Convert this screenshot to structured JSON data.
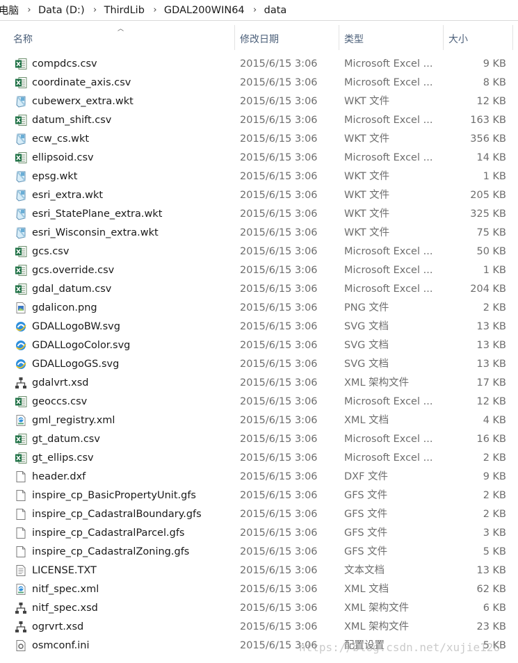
{
  "breadcrumb": {
    "segments": [
      "电脑",
      "Data (D:)",
      "ThirdLib",
      "GDAL200WIN64",
      "data"
    ],
    "separator": "›"
  },
  "columns": {
    "name": "名称",
    "date": "修改日期",
    "type": "类型",
    "size": "大小"
  },
  "files": [
    {
      "name": "compdcs.csv",
      "date": "2015/6/15 3:06",
      "type": "Microsoft Excel ...",
      "size": "9 KB",
      "icon": "excel-icon"
    },
    {
      "name": "coordinate_axis.csv",
      "date": "2015/6/15 3:06",
      "type": "Microsoft Excel ...",
      "size": "8 KB",
      "icon": "excel-icon"
    },
    {
      "name": "cubewerx_extra.wkt",
      "date": "2015/6/15 3:06",
      "type": "WKT 文件",
      "size": "12 KB",
      "icon": "wkt-icon"
    },
    {
      "name": "datum_shift.csv",
      "date": "2015/6/15 3:06",
      "type": "Microsoft Excel ...",
      "size": "163 KB",
      "icon": "excel-icon"
    },
    {
      "name": "ecw_cs.wkt",
      "date": "2015/6/15 3:06",
      "type": "WKT 文件",
      "size": "356 KB",
      "icon": "wkt-icon"
    },
    {
      "name": "ellipsoid.csv",
      "date": "2015/6/15 3:06",
      "type": "Microsoft Excel ...",
      "size": "14 KB",
      "icon": "excel-icon"
    },
    {
      "name": "epsg.wkt",
      "date": "2015/6/15 3:06",
      "type": "WKT 文件",
      "size": "1 KB",
      "icon": "wkt-icon"
    },
    {
      "name": "esri_extra.wkt",
      "date": "2015/6/15 3:06",
      "type": "WKT 文件",
      "size": "205 KB",
      "icon": "wkt-icon"
    },
    {
      "name": "esri_StatePlane_extra.wkt",
      "date": "2015/6/15 3:06",
      "type": "WKT 文件",
      "size": "325 KB",
      "icon": "wkt-icon"
    },
    {
      "name": "esri_Wisconsin_extra.wkt",
      "date": "2015/6/15 3:06",
      "type": "WKT 文件",
      "size": "75 KB",
      "icon": "wkt-icon"
    },
    {
      "name": "gcs.csv",
      "date": "2015/6/15 3:06",
      "type": "Microsoft Excel ...",
      "size": "50 KB",
      "icon": "excel-icon"
    },
    {
      "name": "gcs.override.csv",
      "date": "2015/6/15 3:06",
      "type": "Microsoft Excel ...",
      "size": "1 KB",
      "icon": "excel-icon"
    },
    {
      "name": "gdal_datum.csv",
      "date": "2015/6/15 3:06",
      "type": "Microsoft Excel ...",
      "size": "204 KB",
      "icon": "excel-icon"
    },
    {
      "name": "gdalicon.png",
      "date": "2015/6/15 3:06",
      "type": "PNG 文件",
      "size": "2 KB",
      "icon": "image-icon"
    },
    {
      "name": "GDALLogoBW.svg",
      "date": "2015/6/15 3:06",
      "type": "SVG 文档",
      "size": "13 KB",
      "icon": "svg-icon"
    },
    {
      "name": "GDALLogoColor.svg",
      "date": "2015/6/15 3:06",
      "type": "SVG 文档",
      "size": "13 KB",
      "icon": "svg-icon"
    },
    {
      "name": "GDALLogoGS.svg",
      "date": "2015/6/15 3:06",
      "type": "SVG 文档",
      "size": "13 KB",
      "icon": "svg-icon"
    },
    {
      "name": "gdalvrt.xsd",
      "date": "2015/6/15 3:06",
      "type": "XML 架构文件",
      "size": "17 KB",
      "icon": "xsd-icon"
    },
    {
      "name": "geoccs.csv",
      "date": "2015/6/15 3:06",
      "type": "Microsoft Excel ...",
      "size": "12 KB",
      "icon": "excel-icon"
    },
    {
      "name": "gml_registry.xml",
      "date": "2015/6/15 3:06",
      "type": "XML 文档",
      "size": "4 KB",
      "icon": "xml-icon"
    },
    {
      "name": "gt_datum.csv",
      "date": "2015/6/15 3:06",
      "type": "Microsoft Excel ...",
      "size": "16 KB",
      "icon": "excel-icon"
    },
    {
      "name": "gt_ellips.csv",
      "date": "2015/6/15 3:06",
      "type": "Microsoft Excel ...",
      "size": "2 KB",
      "icon": "excel-icon"
    },
    {
      "name": "header.dxf",
      "date": "2015/6/15 3:06",
      "type": "DXF 文件",
      "size": "9 KB",
      "icon": "blank-file-icon"
    },
    {
      "name": "inspire_cp_BasicPropertyUnit.gfs",
      "date": "2015/6/15 3:06",
      "type": "GFS 文件",
      "size": "2 KB",
      "icon": "blank-file-icon"
    },
    {
      "name": "inspire_cp_CadastralBoundary.gfs",
      "date": "2015/6/15 3:06",
      "type": "GFS 文件",
      "size": "2 KB",
      "icon": "blank-file-icon"
    },
    {
      "name": "inspire_cp_CadastralParcel.gfs",
      "date": "2015/6/15 3:06",
      "type": "GFS 文件",
      "size": "3 KB",
      "icon": "blank-file-icon"
    },
    {
      "name": "inspire_cp_CadastralZoning.gfs",
      "date": "2015/6/15 3:06",
      "type": "GFS 文件",
      "size": "5 KB",
      "icon": "blank-file-icon"
    },
    {
      "name": "LICENSE.TXT",
      "date": "2015/6/15 3:06",
      "type": "文本文档",
      "size": "13 KB",
      "icon": "text-file-icon"
    },
    {
      "name": "nitf_spec.xml",
      "date": "2015/6/15 3:06",
      "type": "XML 文档",
      "size": "62 KB",
      "icon": "xml-icon"
    },
    {
      "name": "nitf_spec.xsd",
      "date": "2015/6/15 3:06",
      "type": "XML 架构文件",
      "size": "6 KB",
      "icon": "xsd-icon"
    },
    {
      "name": "ogrvrt.xsd",
      "date": "2015/6/15 3:06",
      "type": "XML 架构文件",
      "size": "23 KB",
      "icon": "xsd-icon"
    },
    {
      "name": "osmconf.ini",
      "date": "2015/6/15 3:06",
      "type": "配置设置",
      "size": "5 KB",
      "icon": "ini-icon"
    }
  ],
  "watermark": "https://blog.csdn.net/xujie126"
}
